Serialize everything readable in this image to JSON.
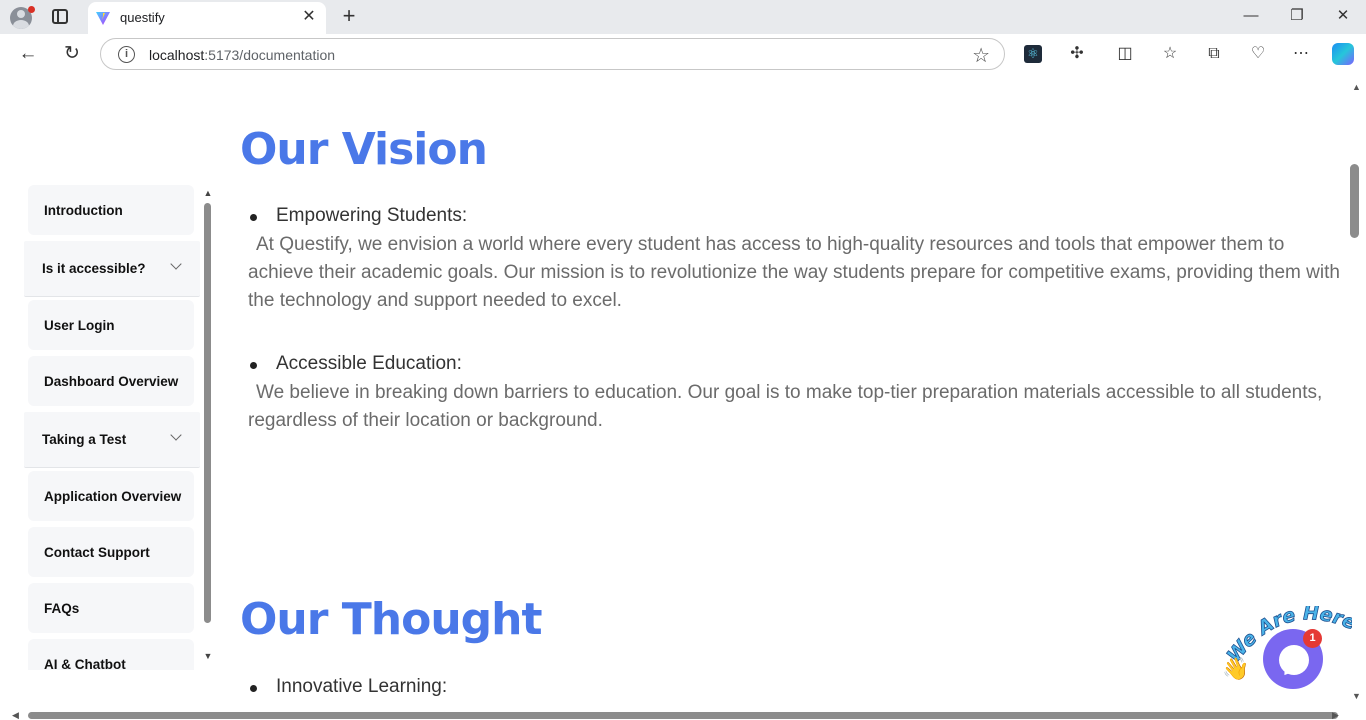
{
  "browser": {
    "tab_title": "questify",
    "url_host": "localhost",
    "url_rest": ":5173/documentation",
    "new_tab_glyph": "+",
    "tab_close_glyph": "✕"
  },
  "sidebar": {
    "items": [
      {
        "label": "Introduction",
        "expandable": false
      },
      {
        "label": "Is it accessible?",
        "expandable": true
      },
      {
        "label": "User Login",
        "expandable": false
      },
      {
        "label": "Dashboard Overview",
        "expandable": false
      },
      {
        "label": "Taking a Test",
        "expandable": true
      },
      {
        "label": "Application Overview",
        "expandable": false
      },
      {
        "label": "Contact Support",
        "expandable": false
      },
      {
        "label": "FAQs",
        "expandable": false
      },
      {
        "label": "AI & Chatbot",
        "expandable": false
      }
    ]
  },
  "content": {
    "section1": {
      "heading": "Our Vision",
      "bullets": [
        {
          "title": "Empowering Students:",
          "text": "At Questify, we envision a world where every student has access to high-quality resources and tools that empower them to achieve their academic goals. Our mission is to revolutionize the way students prepare for competitive exams, providing them with the technology and support needed to excel."
        },
        {
          "title": "Accessible Education:",
          "text": "We believe in breaking down barriers to education. Our goal is to make top-tier preparation materials accessible to all students, regardless of their location or background."
        }
      ]
    },
    "section2": {
      "heading": "Our Thought",
      "bullets": [
        {
          "title": "Innovative Learning:"
        }
      ]
    }
  },
  "chat_widget": {
    "banner_text": "We Are Here!",
    "badge_count": "1",
    "wave_emoji": "👋"
  },
  "colors": {
    "heading_blue": "#4a78e8",
    "chat_purple": "#7a67f0",
    "badge_red": "#e53935"
  },
  "icons": {
    "back": "arrow-left-icon",
    "reload": "reload-icon",
    "favorite": "star-icon",
    "extensions": "puzzle-icon",
    "split_screen": "split-screen-icon",
    "favorites": "favorites-icon",
    "collections": "collections-icon",
    "browser_essentials": "heart-pulse-icon",
    "menu": "more-icon",
    "copilot": "copilot-icon"
  }
}
